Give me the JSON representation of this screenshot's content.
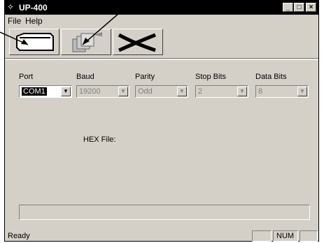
{
  "window": {
    "title": "UP-400",
    "title_icon": "app-icon"
  },
  "menu": {
    "file": "File",
    "help": "Help"
  },
  "toolbar": {
    "open_icon": "folder-open-icon",
    "program_icon": "program-chip-icon",
    "exit_icon": "exit-x-icon"
  },
  "form": {
    "port_label": "Port",
    "baud_label": "Baud",
    "parity_label": "Parity",
    "stopbits_label": "Stop Bits",
    "databits_label": "Data Bits",
    "port_value": "COM1",
    "baud_value": "19200",
    "parity_value": "Odd",
    "stopbits_value": "2",
    "databits_value": "8",
    "hex_file_label": "HEX File:"
  },
  "status": {
    "text": "Ready",
    "num": "NUM"
  }
}
